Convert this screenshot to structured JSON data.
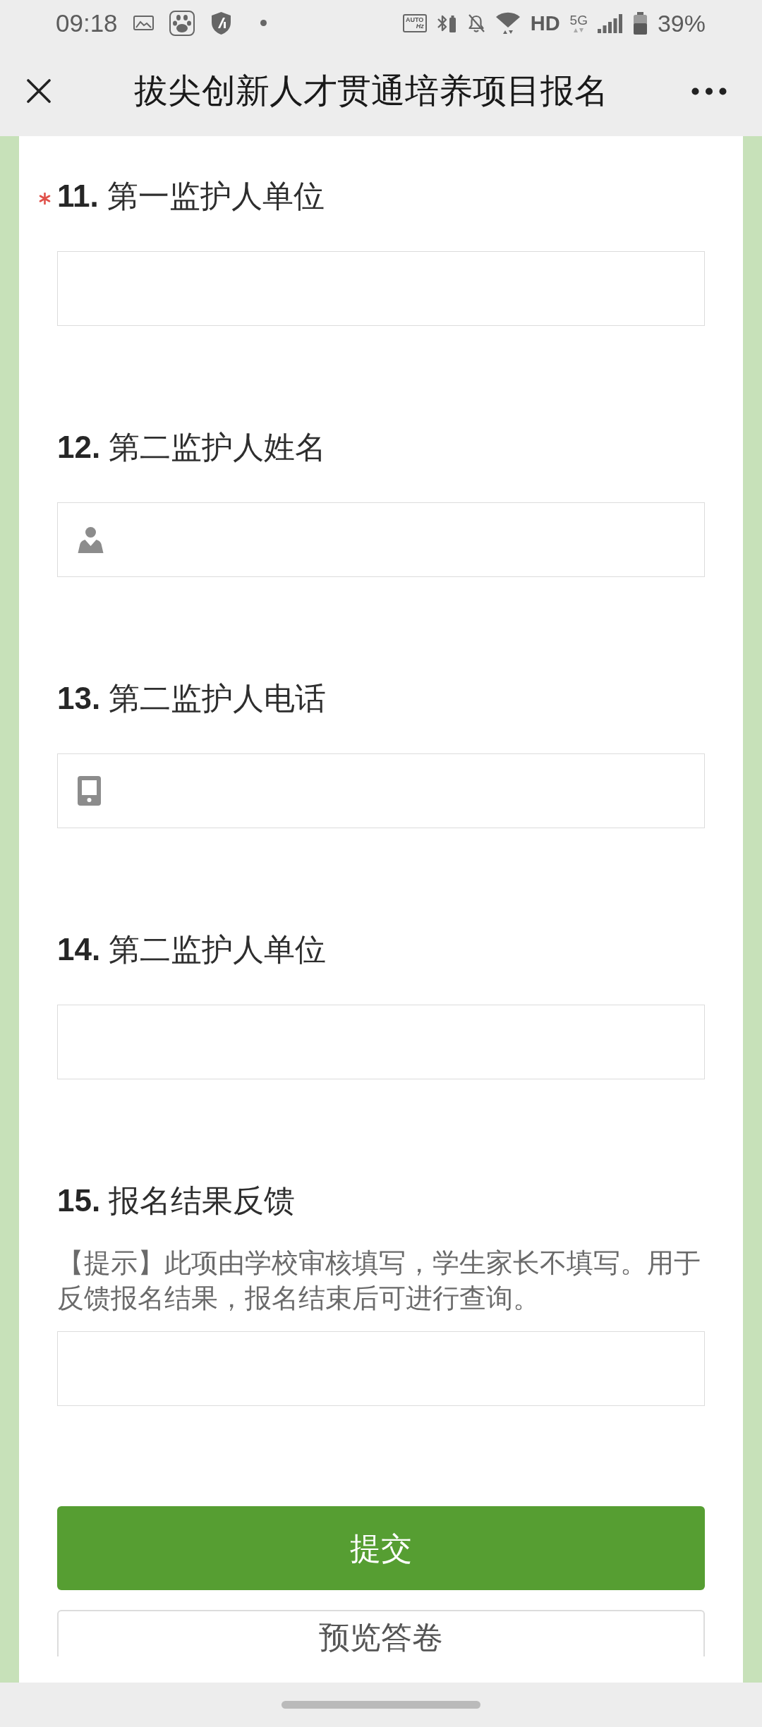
{
  "status_bar": {
    "time": "09:18",
    "refresh_rate": {
      "mode": "AUTO",
      "unit": "Hz"
    },
    "network_quality": "HD",
    "network_type": "5G",
    "battery": "39%"
  },
  "title_bar": {
    "title": "拔尖创新人才贯通培养项目报名"
  },
  "questions": [
    {
      "number": "11.",
      "title": "第一监护人单位",
      "required": true,
      "kind": "text"
    },
    {
      "number": "12.",
      "title": "第二监护人姓名",
      "required": false,
      "kind": "name"
    },
    {
      "number": "13.",
      "title": "第二监护人电话",
      "required": false,
      "kind": "phone"
    },
    {
      "number": "14.",
      "title": "第二监护人单位",
      "required": false,
      "kind": "text"
    },
    {
      "number": "15.",
      "title": "报名结果反馈",
      "required": false,
      "kind": "text",
      "hint": "【提示】此项由学校审核填写，学生家长不填写。用于反馈报名结果，报名结束后可进行查询。"
    }
  ],
  "buttons": [
    {
      "kind": "primary",
      "label": "提交"
    },
    {
      "kind": "secondary",
      "label": "预览答卷"
    }
  ]
}
